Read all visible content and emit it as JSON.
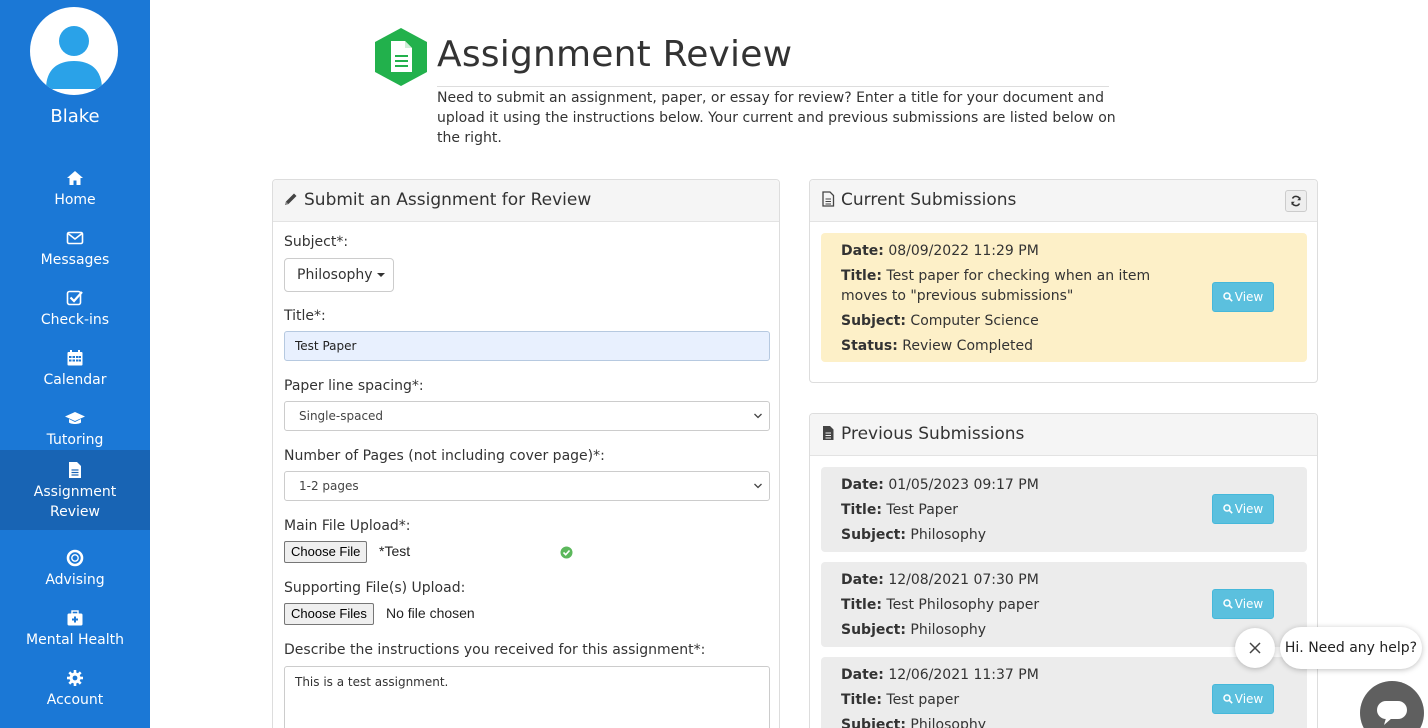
{
  "user": {
    "name": "Blake"
  },
  "nav": [
    {
      "label": "Home",
      "icon": "home-icon"
    },
    {
      "label": "Messages",
      "icon": "envelope-icon"
    },
    {
      "label": "Check-ins",
      "icon": "checkbox-icon"
    },
    {
      "label": "Calendar",
      "icon": "calendar-icon"
    },
    {
      "label": "Tutoring",
      "icon": "graduation-cap-icon"
    },
    {
      "label_line1": "Assignment",
      "label_line2": "Review",
      "icon": "document-icon",
      "active": true
    },
    {
      "label": "Advising",
      "icon": "life-ring-icon"
    },
    {
      "label": "Mental Health",
      "icon": "medkit-icon"
    },
    {
      "label": "Account",
      "icon": "gear-icon"
    }
  ],
  "header": {
    "title": "Assignment Review",
    "intro": "Need to submit an assignment, paper, or essay for review? Enter a title for your document and upload it using the instructions below. Your current and previous submissions are listed below on the right."
  },
  "form": {
    "heading": "Submit an Assignment for Review",
    "subject_label": "Subject*:",
    "subject_value": "Philosophy",
    "title_label": "Title*:",
    "title_value": "Test Paper",
    "spacing_label": "Paper line spacing*:",
    "spacing_value": "Single-spaced",
    "pages_label": "Number of Pages (not including cover page)*:",
    "pages_value": "1-2 pages",
    "main_file_label": "Main File Upload*:",
    "main_file_button": "Choose File",
    "main_file_name": "*Test",
    "supporting_label": "Supporting File(s) Upload:",
    "supporting_button": "Choose Files",
    "supporting_status": "No file chosen",
    "instructions_label": "Describe the instructions you received for this assignment*:",
    "instructions_value": "This is a test assignment."
  },
  "current": {
    "heading": "Current Submissions",
    "items": [
      {
        "date_label": "Date:",
        "date": "08/09/2022 11:29 PM",
        "title_label": "Title:",
        "title_line1": "Test paper for checking when an item",
        "title_line2": "moves to \"previous submissions\"",
        "subject_label": "Subject:",
        "subject": "Computer Science",
        "status_label": "Status:",
        "status": "Review Completed",
        "view_label": "View"
      }
    ]
  },
  "previous": {
    "heading": "Previous Submissions",
    "items": [
      {
        "date_label": "Date:",
        "date": "01/05/2023 09:17 PM",
        "title_label": "Title:",
        "title": "Test Paper",
        "subject_label": "Subject:",
        "subject": "Philosophy",
        "view_label": "View"
      },
      {
        "date_label": "Date:",
        "date": "12/08/2021 07:30 PM",
        "title_label": "Title:",
        "title": "Test Philosophy paper",
        "subject_label": "Subject:",
        "subject": "Philosophy",
        "view_label": "View"
      },
      {
        "date_label": "Date:",
        "date": "12/06/2021 11:37 PM",
        "title_label": "Title:",
        "title": "Test paper",
        "subject_label": "Subject:",
        "subject": "Philosophy",
        "view_label": "View"
      }
    ]
  },
  "chat": {
    "message": "Hi. Need any help?"
  },
  "colors": {
    "sidebar": "#1b78d6",
    "sidebar_active": "#1864b4",
    "logo": "#22b14c",
    "view_button": "#5bc0de",
    "current_card": "#fdf0c8",
    "previous_card": "#ececec"
  }
}
